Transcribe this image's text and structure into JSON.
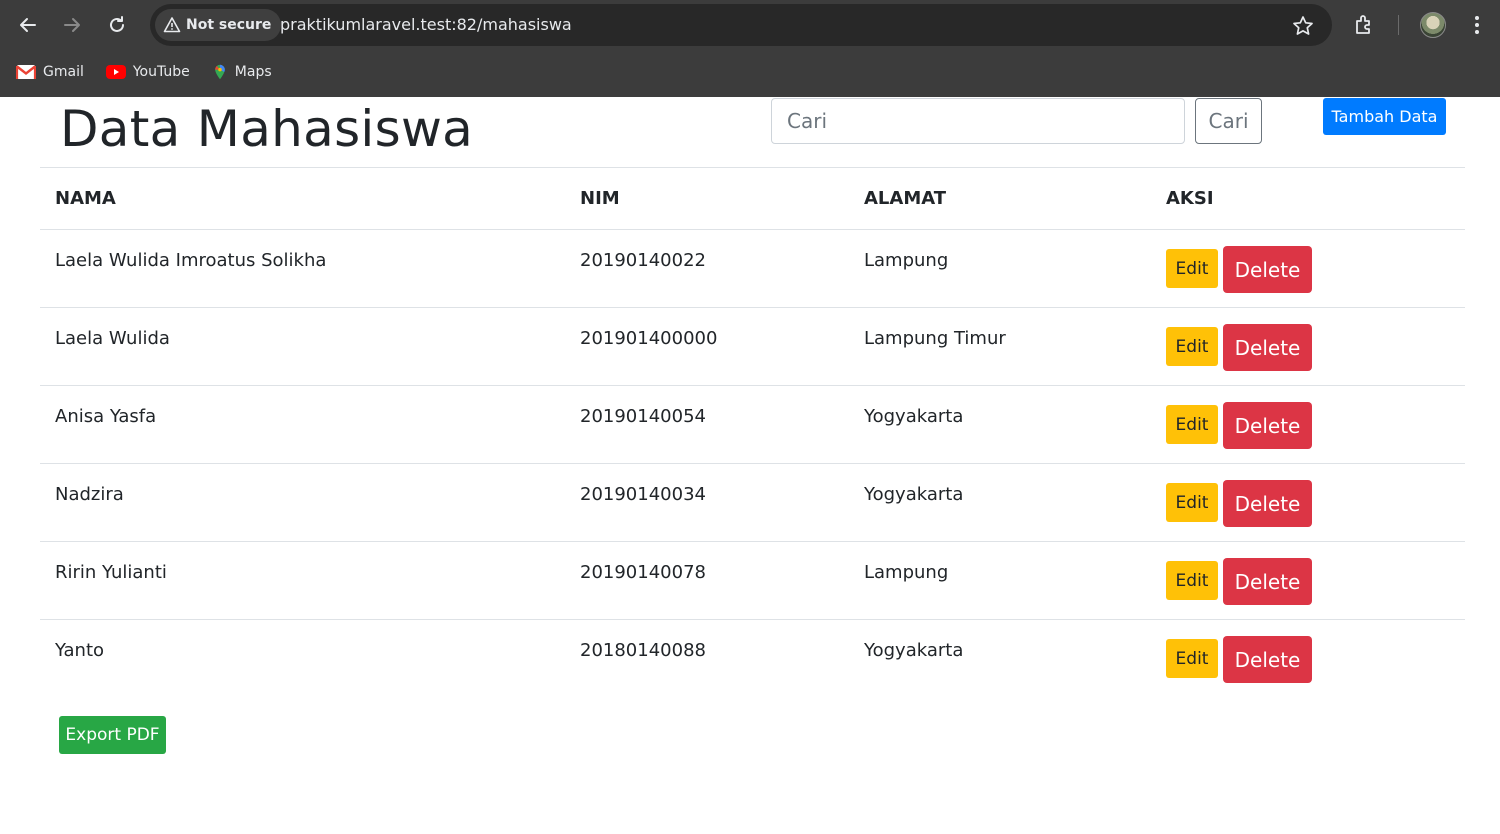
{
  "browser": {
    "security_label": "Not secure",
    "url": "praktikumlaravel.test:82/mahasiswa",
    "bookmarks": [
      {
        "label": "Gmail",
        "icon": "gmail-icon"
      },
      {
        "label": "YouTube",
        "icon": "youtube-icon"
      },
      {
        "label": "Maps",
        "icon": "maps-icon"
      }
    ]
  },
  "page": {
    "title": "Data Mahasiswa",
    "search_placeholder": "Cari",
    "search_button": "Cari",
    "add_button": "Tambah Data",
    "export_button": "Export PDF"
  },
  "table": {
    "headers": [
      "NAMA",
      "NIM",
      "ALAMAT",
      "AKSI"
    ],
    "edit_label": "Edit",
    "delete_label": "Delete",
    "rows": [
      {
        "nama": "Laela Wulida Imroatus Solikha",
        "nim": "20190140022",
        "alamat": "Lampung"
      },
      {
        "nama": "Laela Wulida",
        "nim": "201901400000",
        "alamat": "Lampung Timur"
      },
      {
        "nama": "Anisa Yasfa",
        "nim": "20190140054",
        "alamat": "Yogyakarta"
      },
      {
        "nama": "Nadzira",
        "nim": "20190140034",
        "alamat": "Yogyakarta"
      },
      {
        "nama": "Ririn Yulianti",
        "nim": "20190140078",
        "alamat": "Lampung"
      },
      {
        "nama": "Yanto",
        "nim": "20180140088",
        "alamat": "Yogyakarta"
      }
    ]
  },
  "colors": {
    "primary": "#007bff",
    "warning": "#ffc107",
    "danger": "#dc3545",
    "success": "#28a745",
    "chrome": "#3c3c3c"
  }
}
